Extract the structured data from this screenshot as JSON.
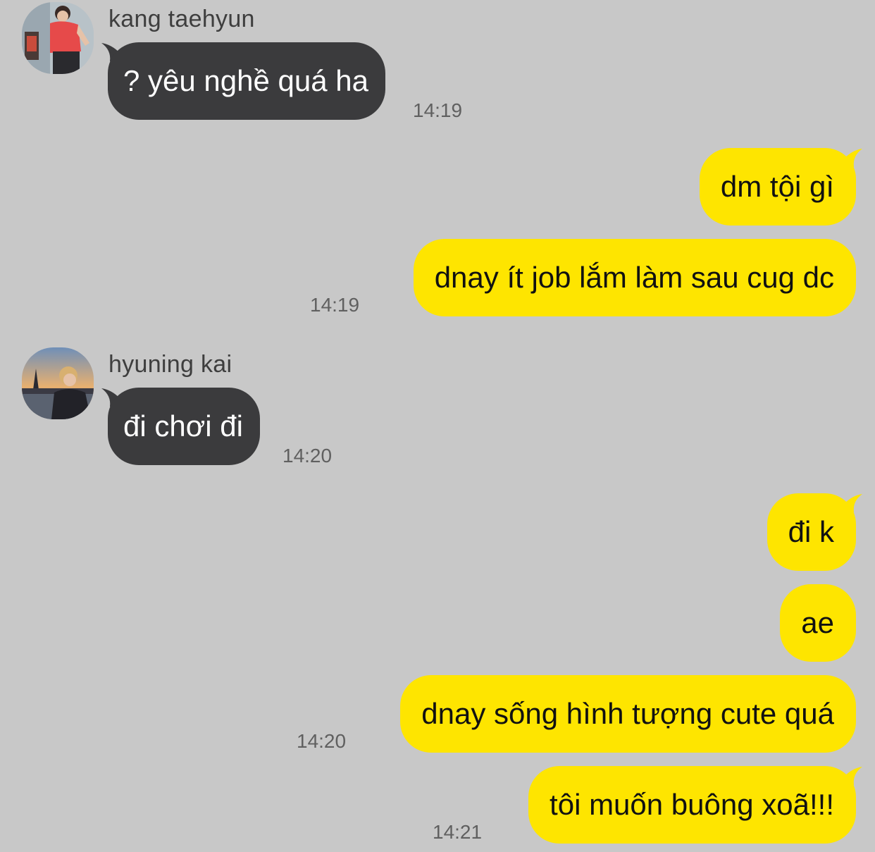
{
  "colors": {
    "background": "#c8c8c8",
    "incoming_bubble": "#3b3b3d",
    "outgoing_bubble": "#fee500",
    "timestamp": "#606060"
  },
  "messages": [
    {
      "type": "in",
      "sender": "kang taehyun",
      "avatar_icon": "profile-photo-red-shirt",
      "text": "? yêu nghề quá ha",
      "time": "14:19"
    },
    {
      "type": "out",
      "text": "dm tội gì"
    },
    {
      "type": "out",
      "text": "dnay ít job lắm làm sau cug dc",
      "time": "14:19"
    },
    {
      "type": "in",
      "sender": "hyuning kai",
      "avatar_icon": "profile-photo-paris-sunset",
      "text": "đi chơi đi",
      "time": "14:20"
    },
    {
      "type": "out",
      "text": "đi k"
    },
    {
      "type": "out",
      "text": "ae"
    },
    {
      "type": "out",
      "text": "dnay sống hình tượng cute quá",
      "time": "14:20"
    },
    {
      "type": "out",
      "text": "tôi muốn buông xoã!!!",
      "time": "14:21"
    }
  ]
}
